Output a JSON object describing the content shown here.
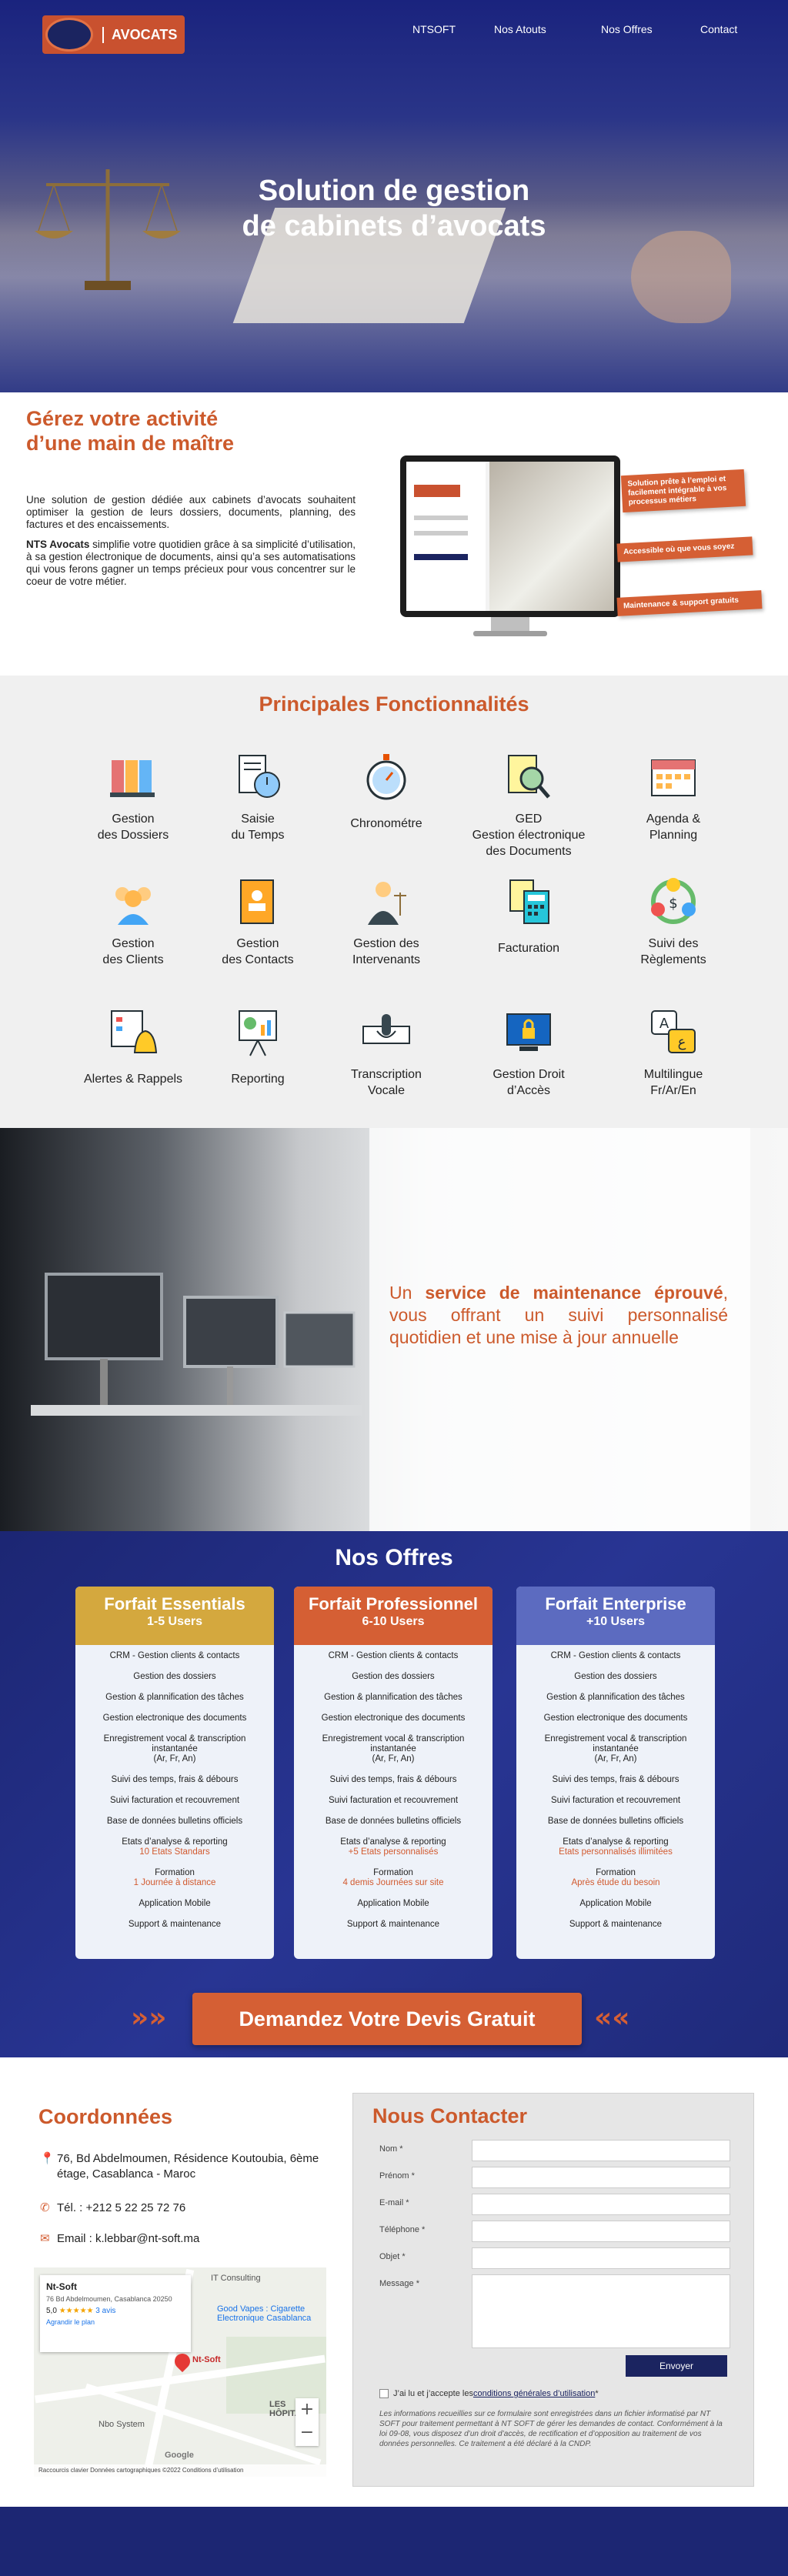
{
  "nav": {
    "brand": "AVOCATS",
    "items": [
      "NTSOFT",
      "Nos Atouts",
      "Nos Offres",
      "Contact"
    ]
  },
  "hero": {
    "title_line1": "Solution de gestion",
    "title_line2": "de cabinets d’avocats"
  },
  "intro": {
    "title_line1": "Gérez votre activité",
    "title_line2": "d’une main de maîtrе",
    "paragraph1": "Une solution de gestion dédiée aux cabinets d’avocats souhaitent optimiser la gestion de leurs dossiers, documents, planning, des factures et des encaissements.",
    "paragraph2_bold": "NTS Avocats",
    "paragraph2": " simplifie votre quotidien grâce à sa simplicité d’utilisation, à sa gestion électronique de documents, ainsi qu’a ses automatisations qui vous ferons gagner un temps précieux pour vous concentrer sur le coeur de votre métier.",
    "badges": [
      "Solution prête à l’emploi et facilement intégrable à vos processus métiers",
      "Accessible où que vous soyez",
      "Maintenance & support gratuits"
    ]
  },
  "features": {
    "title": "Principales Fonctionnalités",
    "items": [
      {
        "label": "Gestion\ndes Dossiers",
        "icon": "folders-icon"
      },
      {
        "label": "Saisie\ndu Temps",
        "icon": "timesheet-icon"
      },
      {
        "label": "Chronométre",
        "icon": "stopwatch-icon"
      },
      {
        "label": "GED\nGestion électronique\ndes Documents",
        "icon": "document-search-icon"
      },
      {
        "label": "Agenda &\nPlanning",
        "icon": "calendar-icon"
      },
      {
        "label": "Gestion\ndes Clients",
        "icon": "clients-icon"
      },
      {
        "label": "Gestion\ndes Contacts",
        "icon": "contacts-book-icon"
      },
      {
        "label": "Gestion des\nIntervenants",
        "icon": "lawyer-icon"
      },
      {
        "label": "Facturation",
        "icon": "calculator-icon"
      },
      {
        "label": "Suivi des\nRèglements",
        "icon": "payments-icon"
      },
      {
        "label": "Alertes & Rappels",
        "icon": "alert-bell-icon"
      },
      {
        "label": "Reporting",
        "icon": "presentation-chart-icon"
      },
      {
        "label": "Transcription\nVocale",
        "icon": "microphone-icon"
      },
      {
        "label": "Gestion Droit\nd’Accès",
        "icon": "lock-screen-icon"
      },
      {
        "label": "Multilingue\nFr/Ar/En",
        "icon": "translate-icon"
      }
    ]
  },
  "maintenance": {
    "text_a": "Un ",
    "text_bold": "service de maintenance éprouvé",
    "text_b": ", vous offrant un suivi personnalisé quotidien et une mise à jour annuelle"
  },
  "offres": {
    "title": "Nos Offres",
    "plans": [
      {
        "name": "Forfait Essentials",
        "users": "1-5 Users",
        "color": "#d4a83e",
        "features": [
          "CRM - Gestion clients & contacts",
          "Gestion des dossiers",
          "Gestion & plannification des tâches",
          "Gestion electronique des documents",
          "Enregistrement vocal & transcription instantanée\n(Ar, Fr, An)",
          "Suivi des temps, frais & débours",
          "Suivi facturation et recouvrement",
          "Base de données bulletins officiels",
          "Etats d’analyse & reporting",
          "Formation",
          "Application Mobile",
          "Support & maintenance"
        ],
        "reporting_detail": "10 Etats Standars",
        "formation_detail": "1 Journée à distance"
      },
      {
        "name": "Forfait Professionnel",
        "users": "6-10 Users",
        "color": "#d55f34",
        "features": [
          "CRM - Gestion clients & contacts",
          "Gestion des dossiers",
          "Gestion & plannification des tâches",
          "Gestion electronique des documents",
          "Enregistrement vocal & transcription instantanée\n(Ar, Fr, An)",
          "Suivi des temps, frais & débours",
          "Suivi facturation et recouvrement",
          "Base de données bulletins officiels",
          "Etats d’analyse & reporting",
          "Formation",
          "Application Mobile",
          "Support & maintenance"
        ],
        "reporting_detail": "+5 Etats personnalisés",
        "formation_detail": "4 demis Journées sur site"
      },
      {
        "name": "Forfait Enterprise",
        "users": "+10 Users",
        "color": "#5c6bc0",
        "features": [
          "CRM - Gestion clients & contacts",
          "Gestion des dossiers",
          "Gestion & plannification des tâches",
          "Gestion electronique des documents",
          "Enregistrement vocal & transcription instantanée\n(Ar, Fr, An)",
          "Suivi des temps, frais & débours",
          "Suivi facturation et recouvrement",
          "Base de données bulletins officiels",
          "Etats d’analyse & reporting",
          "Formation",
          "Application Mobile",
          "Support & maintenance"
        ],
        "reporting_detail": "Etats personnalisés illimitées",
        "formation_detail": "Après étude du besoin"
      }
    ],
    "cta": "Demandez Votre Devis Gratuit"
  },
  "contact": {
    "coord_title": "Coordonnées",
    "address": "76, Bd Abdelmoumen, Résidence Koutoubia, 6ème étage, Casablanca - Maroc",
    "phone": "Tél. : +212 5 22 25 72 76",
    "email": "Email : k.lebbar@nt-soft.ma",
    "map": {
      "place": "Nt-Soft",
      "place_address": "76 Bd Abdelmoumen, Casablanca 20250",
      "rating": "5,0",
      "stars": "★★★★★",
      "reviews": "3 avis",
      "enlarge": "Agrandir le plan",
      "labels": [
        "IT Consulting",
        "Good Vapes : Cigarette Electronique Casablanca",
        "Nt-Soft",
        "Nbo System",
        "LES HÔPITAUX"
      ],
      "attribution": "Google",
      "footer": "Raccourcis clavier   Données cartographiques ©2022   Conditions d’utilisation"
    },
    "form_title": "Nous Contacter",
    "fields": [
      "Nom *",
      "Prénom *",
      "E-mail *",
      "Téléphone *",
      "Objet *",
      "Message *"
    ],
    "send": "Envoyer",
    "cgu_a": "J’ai lu et j’accepte les ",
    "cgu_link": "conditions générales d’utilisation",
    "cgu_b": " *",
    "legal": "Les informations recueillies sur ce formulaire sont enregistrées dans un fichier informatisé par NT SOFT pour traitement permettant à NT SOFT de gérer les demandes de contact. Conformément à la loi 09-08, vous disposez d’un droit d’accès, de rectification et d’opposition au traitement de vos données personnelles. Ce traitement a été déclaré à la CNDP."
  }
}
